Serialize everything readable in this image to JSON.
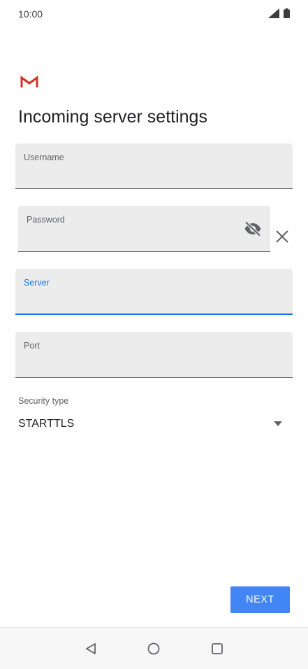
{
  "status_bar": {
    "time": "10:00",
    "icons": [
      "signal-icon",
      "battery-icon"
    ]
  },
  "header": {
    "logo": "gmail-logo",
    "title": "Incoming server settings"
  },
  "form": {
    "username": {
      "label": "Username",
      "value": ""
    },
    "password": {
      "label": "Password",
      "value": "",
      "toggle_icon": "visibility-off-icon",
      "clear_icon": "close-icon"
    },
    "server": {
      "label": "Server",
      "value": "",
      "focused": true
    },
    "port": {
      "label": "Port",
      "value": ""
    },
    "security_type": {
      "label": "Security type",
      "value": "STARTTLS",
      "icon": "dropdown-arrow-icon"
    }
  },
  "actions": {
    "next_label": "NEXT"
  },
  "navigation": {
    "items": [
      "back-icon",
      "home-icon",
      "recents-icon"
    ]
  },
  "colors": {
    "accent": "#1a73e8",
    "button": "#4285f4",
    "field_bg": "#ececec",
    "gmail_red": "#d93025"
  }
}
